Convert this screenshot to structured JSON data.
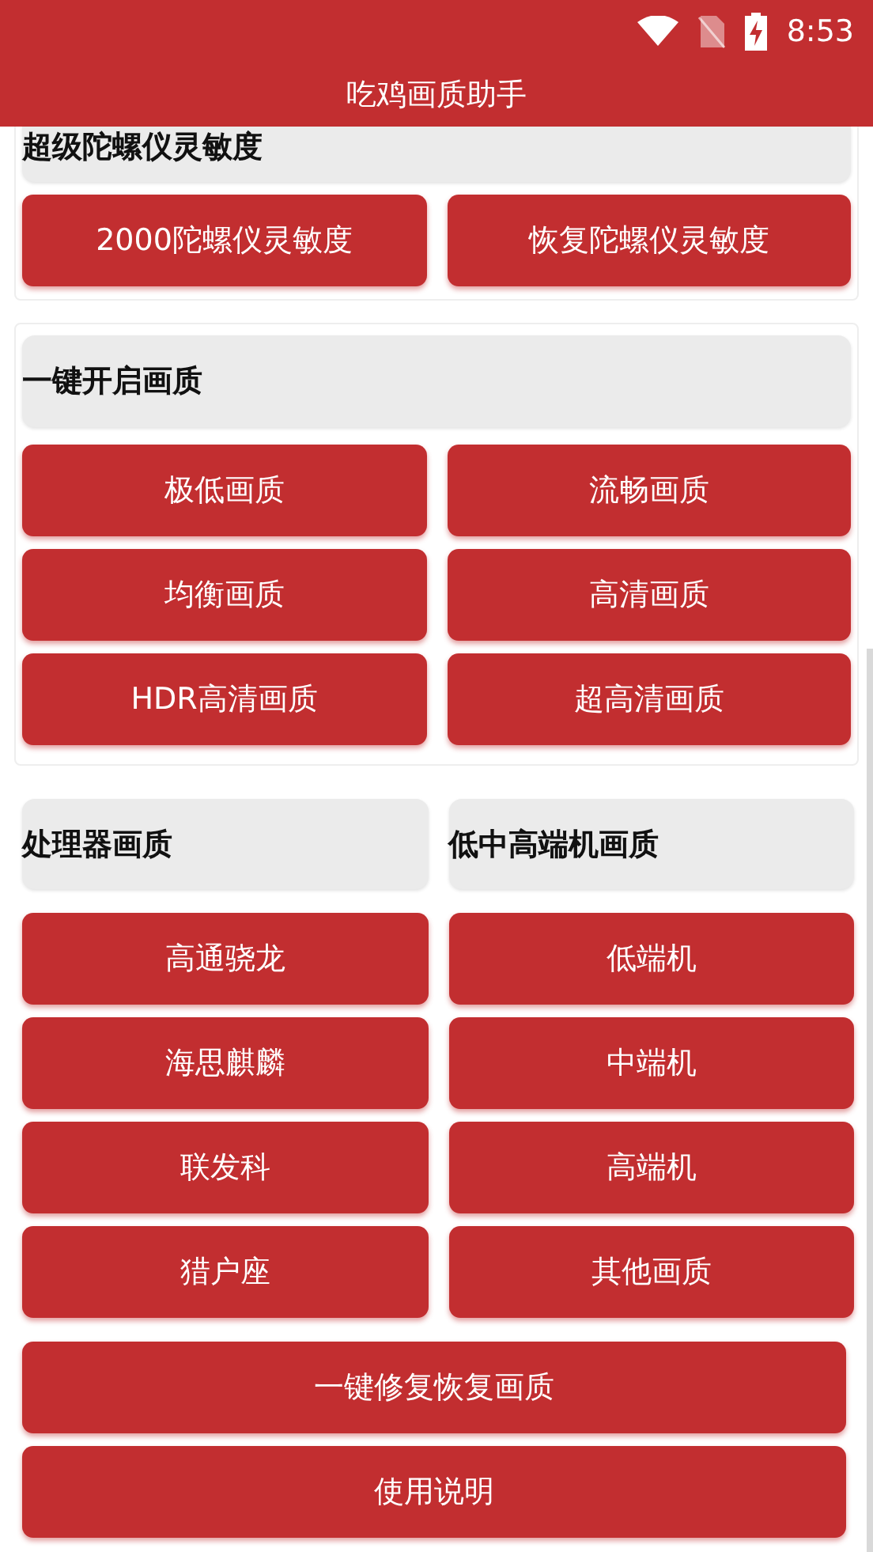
{
  "status_bar": {
    "time": "8:53"
  },
  "app_bar": {
    "title": "吃鸡画质助手"
  },
  "sections": [
    {
      "title": "超级陀螺仪灵敏度",
      "buttons": [
        "2000陀螺仪灵敏度",
        "恢复陀螺仪灵敏度"
      ]
    },
    {
      "title": "一键开启画质",
      "buttons": [
        "极低画质",
        "流畅画质",
        "均衡画质",
        "高清画质",
        "HDR高清画质",
        "超高清画质"
      ]
    }
  ],
  "columns": [
    {
      "title": "处理器画质",
      "buttons": [
        "高通骁龙",
        "海思麒麟",
        "联发科",
        "猎户座"
      ]
    },
    {
      "title": "低中高端机画质",
      "buttons": [
        "低端机",
        "中端机",
        "高端机",
        "其他画质"
      ]
    }
  ],
  "actions": [
    "一键修复恢复画质",
    "使用说明"
  ]
}
